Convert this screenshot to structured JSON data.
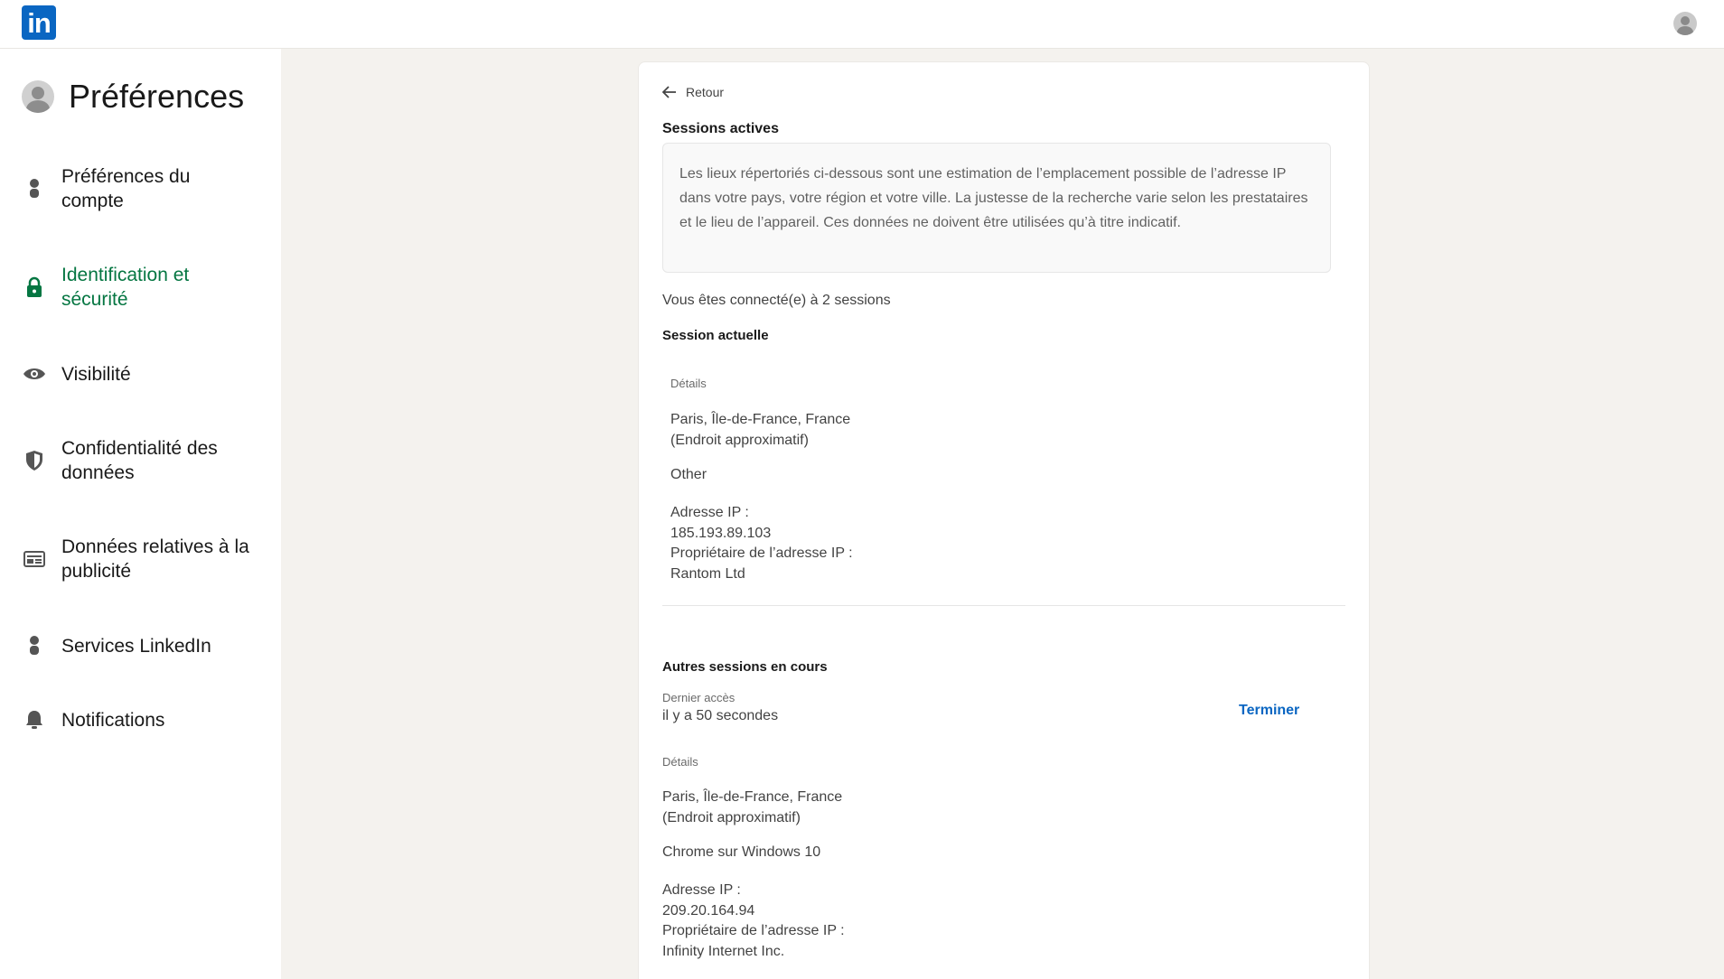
{
  "brand": {
    "logo_text": "in",
    "color": "#0a66c2"
  },
  "sidebar": {
    "title": "Préférences",
    "active_color": "#057642",
    "items": [
      {
        "label": "Préférences du compte",
        "icon": "person-icon"
      },
      {
        "label": "Identification et sécurité",
        "icon": "lock-icon",
        "active": true
      },
      {
        "label": "Visibilité",
        "icon": "eye-icon"
      },
      {
        "label": "Confidentialité des données",
        "icon": "shield-icon"
      },
      {
        "label": "Données relatives à la publicité",
        "icon": "newspaper-icon"
      },
      {
        "label": "Services LinkedIn",
        "icon": "person-icon"
      },
      {
        "label": "Notifications",
        "icon": "bell-icon"
      }
    ]
  },
  "main": {
    "back_label": "Retour",
    "title": "Sessions actives",
    "info_text": "Les lieux répertoriés ci-dessous sont une estimation de l’emplacement possible de l’adresse IP dans votre pays, votre région et votre ville. La justesse de la recherche varie selon les prestataires et le lieu de l’appareil. Ces données ne doivent être utilisées qu’à titre indicatif.",
    "session_count_text": "Vous êtes connecté(e) à 2 sessions",
    "current": {
      "heading": "Session actuelle",
      "details_label": "Détails",
      "location": "Paris, Île-de-France, France",
      "location_note": "(Endroit approximatif)",
      "device": "Other",
      "ip_label": "Adresse IP :",
      "ip": "185.193.89.103",
      "owner_label": "Propriétaire de l’adresse IP :",
      "owner": "Rantom Ltd"
    },
    "others": {
      "heading": "Autres sessions en cours",
      "last_access_label": "Dernier accès",
      "last_access_value": "il y a 50 secondes",
      "end_button": "Terminer",
      "details_label": "Détails",
      "location": "Paris, Île-de-France, France",
      "location_note": "(Endroit approximatif)",
      "device": "Chrome sur Windows 10",
      "ip_label": "Adresse IP :",
      "ip": "209.20.164.94",
      "owner_label": "Propriétaire de l’adresse IP :",
      "owner": "Infinity Internet Inc."
    }
  }
}
